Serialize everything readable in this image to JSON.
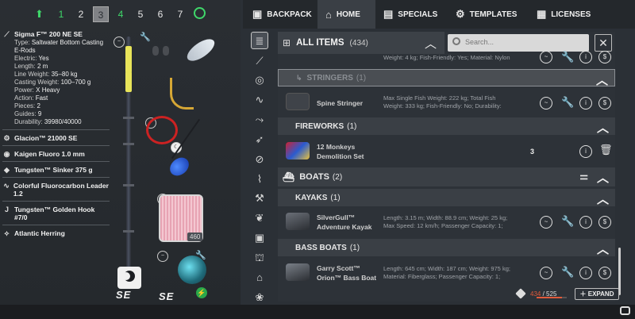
{
  "rod_tabs": [
    "1",
    "2",
    "3",
    "4",
    "5",
    "6",
    "7"
  ],
  "rod": {
    "name": "Sigma F™ 200 NE SE",
    "specs": [
      {
        "label": "Type:",
        "value": "Saltwater Bottom Casting E-Rods"
      },
      {
        "label": "Electric:",
        "value": "Yes"
      },
      {
        "label": "Length:",
        "value": "2 m"
      },
      {
        "label": "Line Weight:",
        "value": "35–80 kg"
      },
      {
        "label": "Casting Weight:",
        "value": "100–700 g"
      },
      {
        "label": "Power:",
        "value": "X Heavy"
      },
      {
        "label": "Action:",
        "value": "Fast"
      },
      {
        "label": "Pieces:",
        "value": "2"
      },
      {
        "label": "Guides:",
        "value": "9"
      },
      {
        "label": "Durability:",
        "value": "39980/40000"
      }
    ]
  },
  "equipment": [
    {
      "name": "Glacion™ 21000 SE",
      "icon": "reel-icon"
    },
    {
      "name": "Kaigen Fluoro 1.0 mm",
      "icon": "line-icon"
    },
    {
      "name": "Tungsten™ Sinker 375 g",
      "icon": "sinker-icon"
    },
    {
      "name": "Colorful Fluorocarbon Leader 1.2",
      "icon": "leader-icon"
    },
    {
      "name": "Tungsten™ Golden Hook #7/0",
      "icon": "hook-icon"
    },
    {
      "name": "Atlantic Herring",
      "icon": "bait-icon"
    }
  ],
  "slot_labels": {
    "line_count": "460",
    "brand_left": "SE",
    "brand_right": "SE"
  },
  "topbar": {
    "tabs": [
      "BACKPACK",
      "HOME",
      "SPECIALS",
      "TEMPLATES",
      "LICENSES"
    ]
  },
  "list": {
    "header_title": "ALL ITEMS",
    "header_count": "(434)",
    "search_placeholder": "Search...",
    "close_label": "✕",
    "cut_desc": "Weight: 4 kg; Fish-Friendly: Yes; Material: Nylon",
    "stringers_label": "STRINGERS",
    "stringers_count": "(1)",
    "stringer_name": "Spine Stringer",
    "stringer_desc_1": "Max Single Fish Weight: 222 kg; Total Fish",
    "stringer_desc_2": "Weight: 333 kg; Fish-Friendly: No; Durability:",
    "fireworks_label": "FIREWORKS",
    "fireworks_count": "(1)",
    "firework_name_1": "12 Monkeys",
    "firework_name_2": "Demolition Set",
    "firework_qty": "3",
    "boats_label": "BOATS",
    "boats_count": "(2)",
    "kayaks_label": "KAYAKS",
    "kayaks_count": "(1)",
    "kayak_name_1": "SilverGull™",
    "kayak_name_2": "Adventure Kayak",
    "kayak_desc_1": "Length: 3.15 m; Width: 88.9 cm; Weight: 25 kg;",
    "kayak_desc_2": "Max Speed: 12 km/h; Passenger Capacity: 1;",
    "bassboats_label": "BASS BOATS",
    "bassboats_count": "(1)",
    "bassboat_name_1": "Garry Scott™",
    "bassboat_name_2": "Orion™ Bass Boat",
    "bassboat_desc_1": "Length: 645 cm; Width: 187 cm; Weight: 975 kg;",
    "bassboat_desc_2": "Material: Fiberglass; Passenger Capacity: 1;"
  },
  "storage": {
    "used": "434",
    "total": "/ 525",
    "fill_fraction": 0.83
  },
  "expand_label": "EXPAND",
  "colors": {
    "accent_green": "#3fd76a",
    "storage_red": "#e05a3b"
  }
}
